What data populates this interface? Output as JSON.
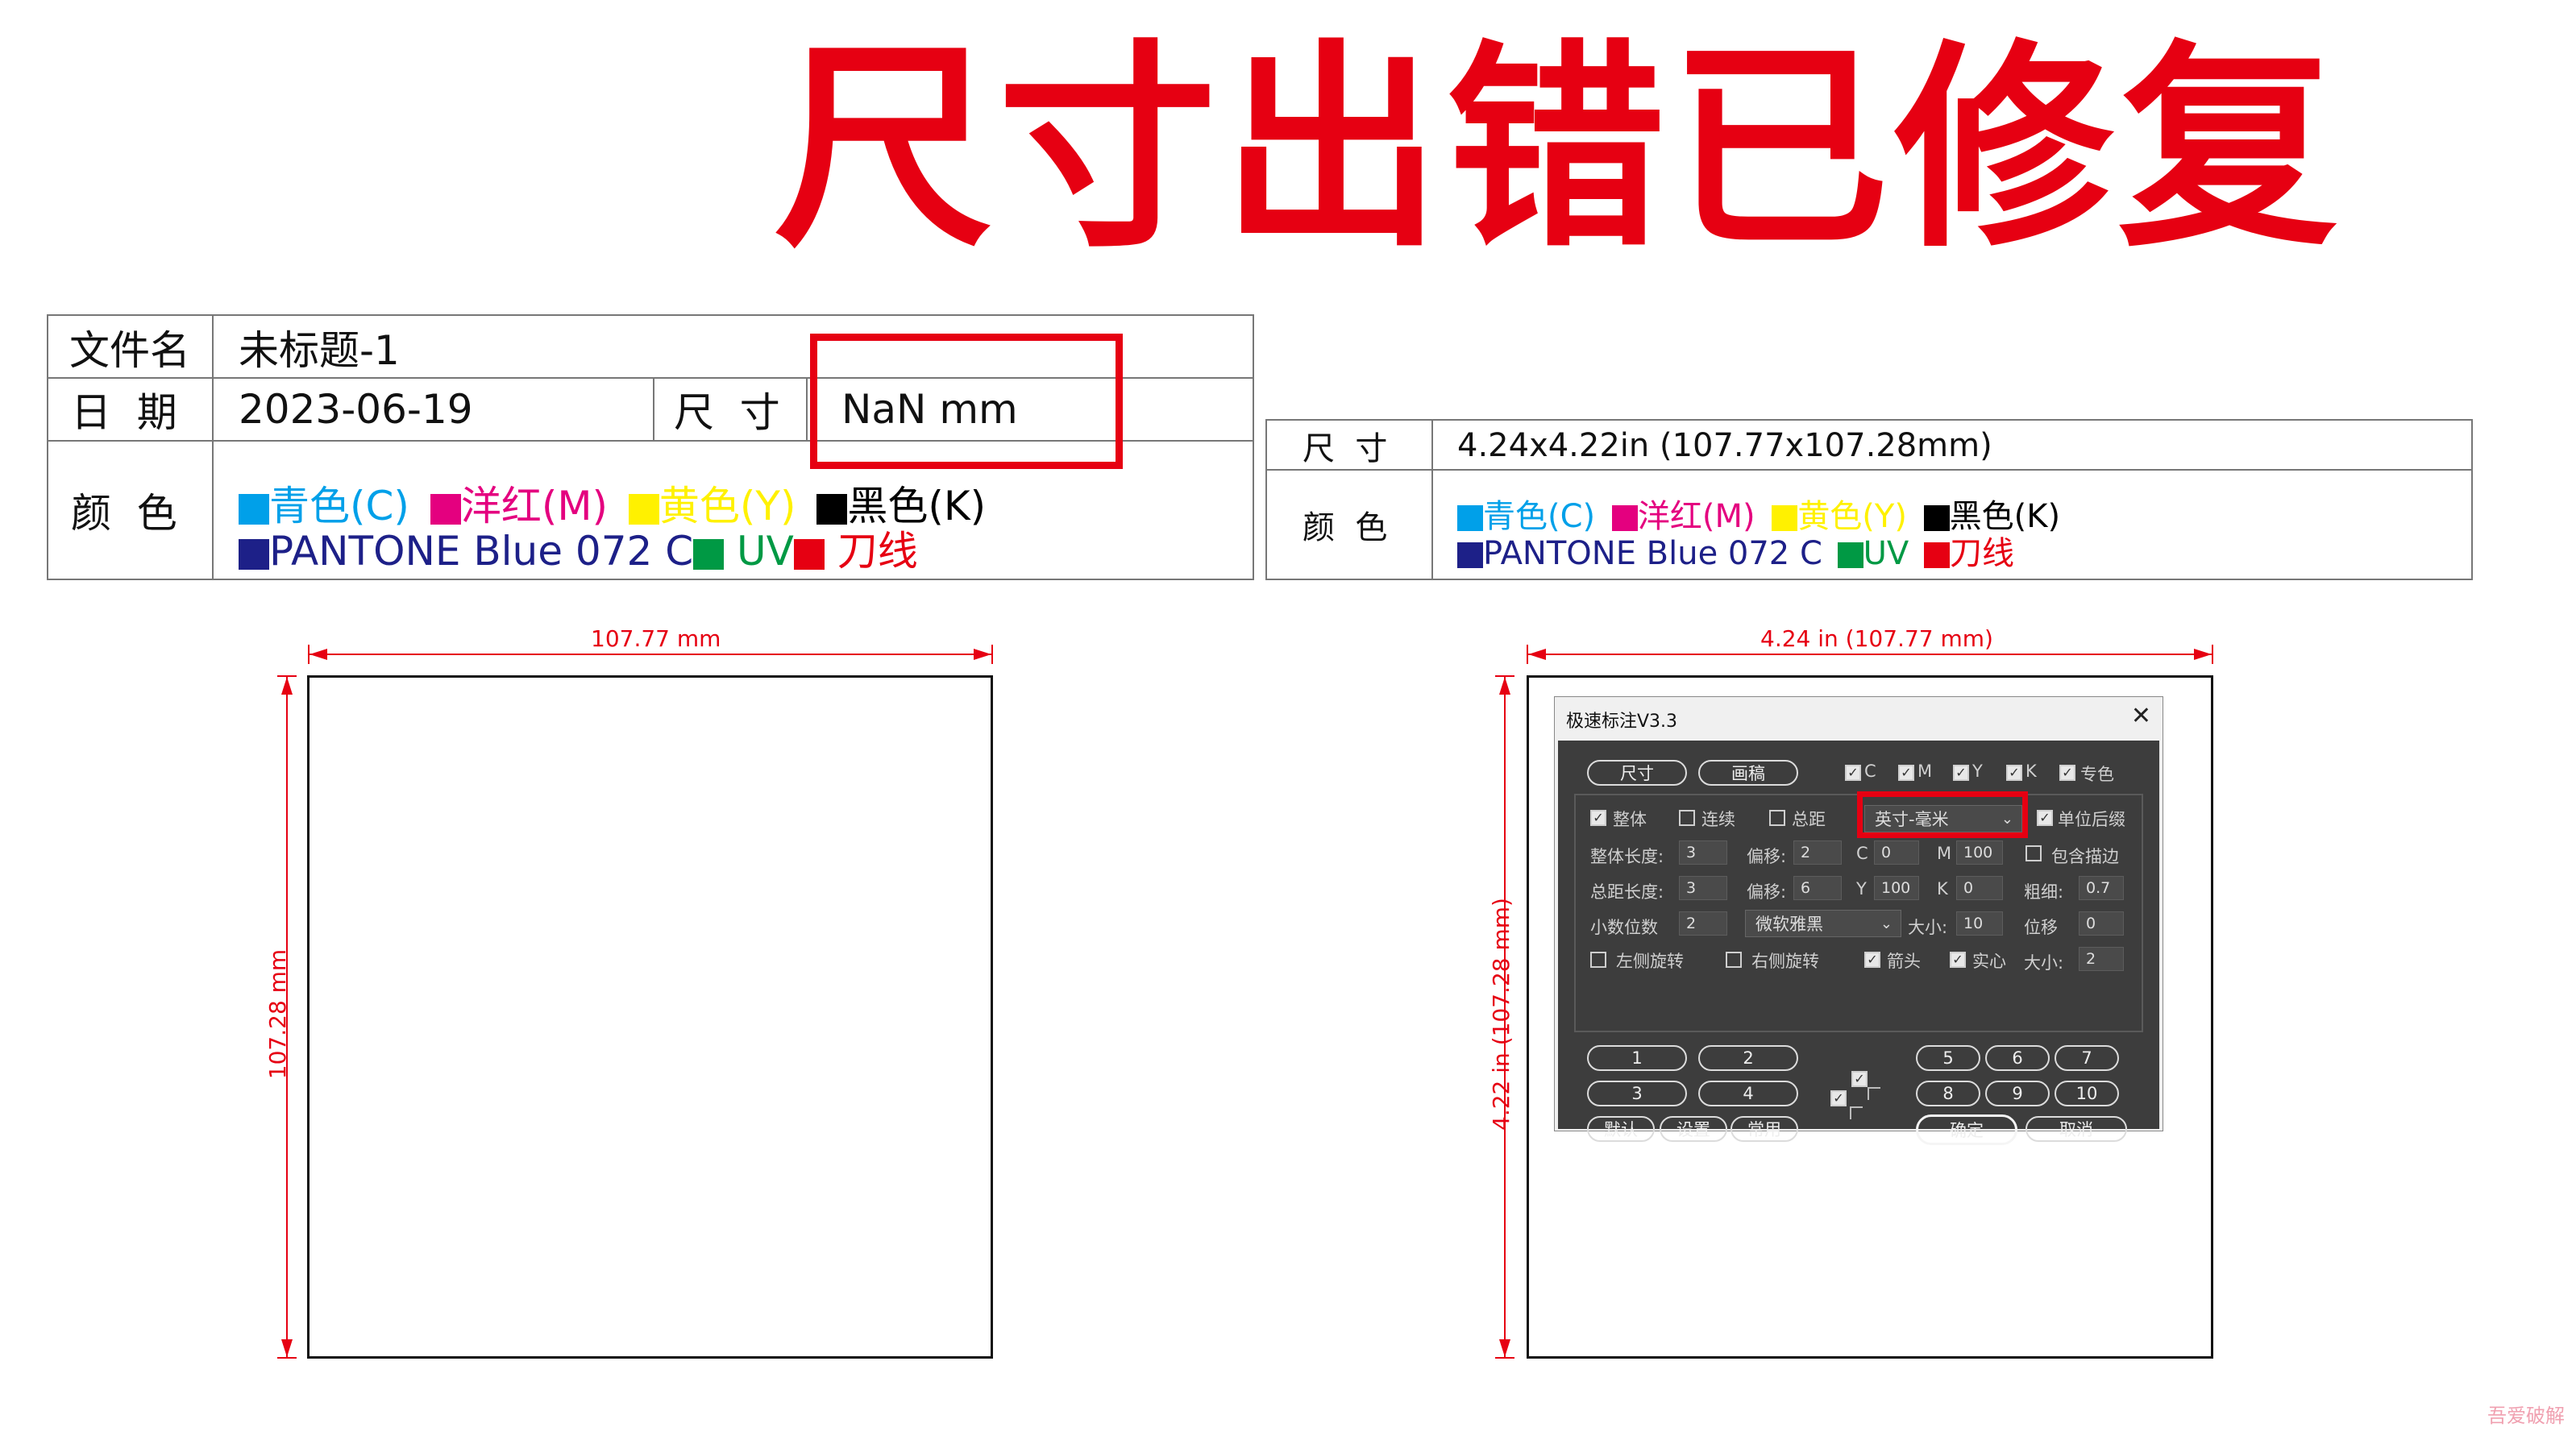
{
  "headline": "尺寸出错已修复",
  "left_table": {
    "filename_label": "文件名",
    "filename_value": "未标题-1",
    "date_label": "日  期",
    "date_value": "2023-06-19",
    "size_label": "尺  寸",
    "size_value": "NaN mm",
    "color_label": "颜  色",
    "colors_line1": [
      "青色(C)",
      "洋红(M)",
      "黄色(Y)",
      "黑色(K)"
    ],
    "colors_line2": [
      "PANTONE Blue 072 C",
      "UV",
      "刀线"
    ]
  },
  "right_table": {
    "size_label": "尺  寸",
    "size_value": "4.24x4.22in (107.77x107.28mm)",
    "color_label": "颜  色",
    "colors_line1": [
      "青色(C)",
      "洋红(M)",
      "黄色(Y)",
      "黑色(K)"
    ],
    "colors_line2": [
      "PANTONE Blue 072 C",
      "UV",
      "刀线"
    ]
  },
  "swatch_colors": {
    "cyan": "#00a0e9",
    "magenta": "#e4007f",
    "yellow": "#fff100",
    "black": "#000000",
    "pantone": "#1d2088",
    "uv": "#009944",
    "dieline": "#e60012"
  },
  "left_artboard": {
    "width_label": "107.77 mm",
    "height_label": "107.28 mm"
  },
  "right_artboard": {
    "width_label": "4.24 in (107.77 mm)",
    "height_label": "4.22 in (107.28 mm)"
  },
  "dialog": {
    "title": "极速标注V3.3",
    "btn_size": "尺寸",
    "btn_canvas": "画稿",
    "cmyk_checks": [
      "C",
      "M",
      "Y",
      "K",
      "专色"
    ],
    "opt_whole": "整体",
    "opt_continuous": "连续",
    "opt_total": "总距",
    "unit_select": "英寸-毫米",
    "opt_unit_suffix": "单位后缀",
    "whole_len_label": "整体长度:",
    "whole_len_value": "3",
    "offset_label": "偏移:",
    "offset1_value": "2",
    "total_len_label": "总距长度:",
    "total_len_value": "3",
    "offset2_value": "6",
    "c_label": "C",
    "c_value": "0",
    "m_label": "M",
    "m_value": "100",
    "y_label": "Y",
    "y_value": "100",
    "k_label": "K",
    "k_value": "0",
    "include_stroke": "包含描边",
    "thickness_label": "粗细:",
    "thickness_value": "0.7",
    "decimals_label": "小数位数",
    "decimals_value": "2",
    "font_select": "微软雅黑",
    "size_label": "大小:",
    "size_value": "10",
    "shift_label": "位移",
    "shift_value": "0",
    "left_rotate": "左侧旋转",
    "right_rotate": "右侧旋转",
    "arrow": "箭头",
    "solid": "实心",
    "size2_label": "大小:",
    "size2_value": "2",
    "num_left": [
      "1",
      "2",
      "3",
      "4"
    ],
    "num_right": [
      "5",
      "6",
      "7",
      "8",
      "9",
      "10"
    ],
    "btn_default": "默认",
    "btn_settings": "设置",
    "btn_common": "常用",
    "btn_ok": "确定",
    "btn_cancel": "取消"
  },
  "watermark": "吾爱破解"
}
